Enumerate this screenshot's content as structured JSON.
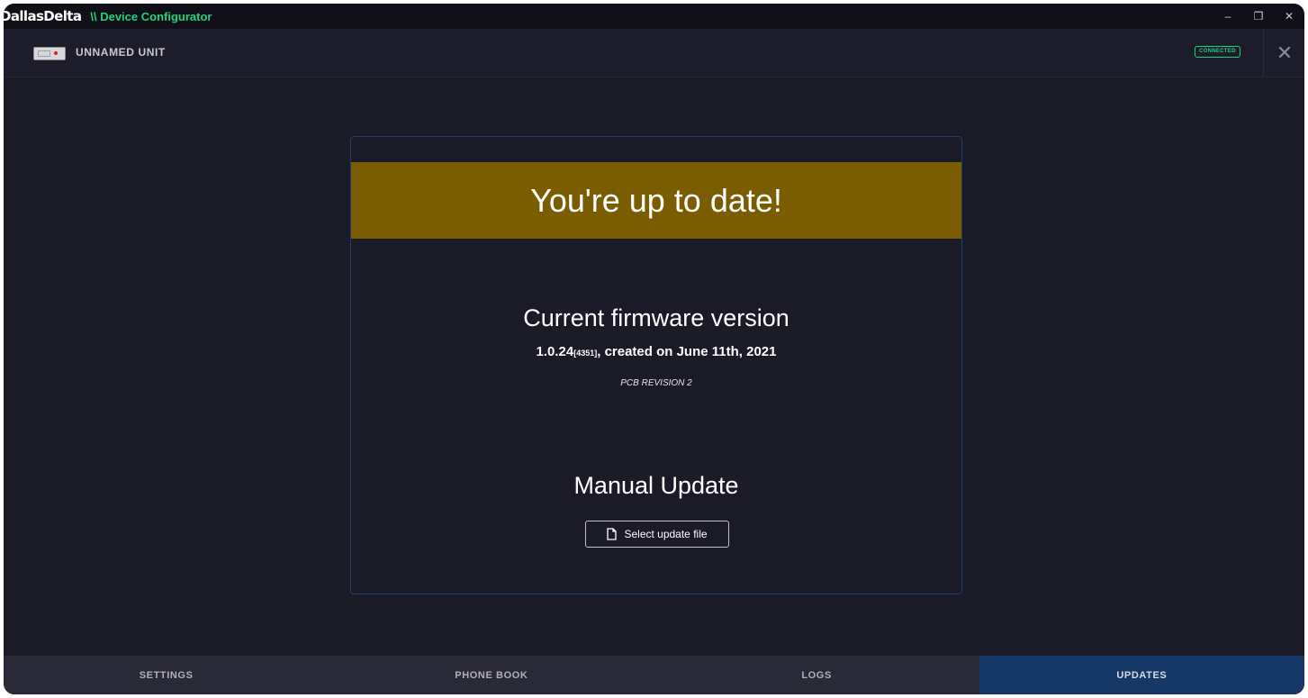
{
  "titlebar": {
    "brand": "DallasDelta",
    "app_name": "\\\\ Device Configurator",
    "minimize": "–",
    "restore": "❐",
    "close": "✕"
  },
  "unit": {
    "name": "UNNAMED UNIT",
    "status": "CONNECTED",
    "close_symbol": "✕"
  },
  "update_card": {
    "banner": "You're up to date!",
    "firmware_heading": "Current firmware version",
    "firmware_version": "1.0.24",
    "firmware_build": "[4351]",
    "firmware_created": ", created on June 11th, 2021",
    "pcb_revision": "PCB REVISION 2",
    "manual_heading": "Manual Update",
    "select_button": "Select update file"
  },
  "tabs": [
    {
      "label": "SETTINGS"
    },
    {
      "label": "PHONE BOOK"
    },
    {
      "label": "LOGS"
    },
    {
      "label": "UPDATES"
    }
  ],
  "colors": {
    "accent_green": "#1fd27a",
    "banner": "#7a5d00",
    "active_tab": "#153866",
    "background": "#1b1a27"
  }
}
